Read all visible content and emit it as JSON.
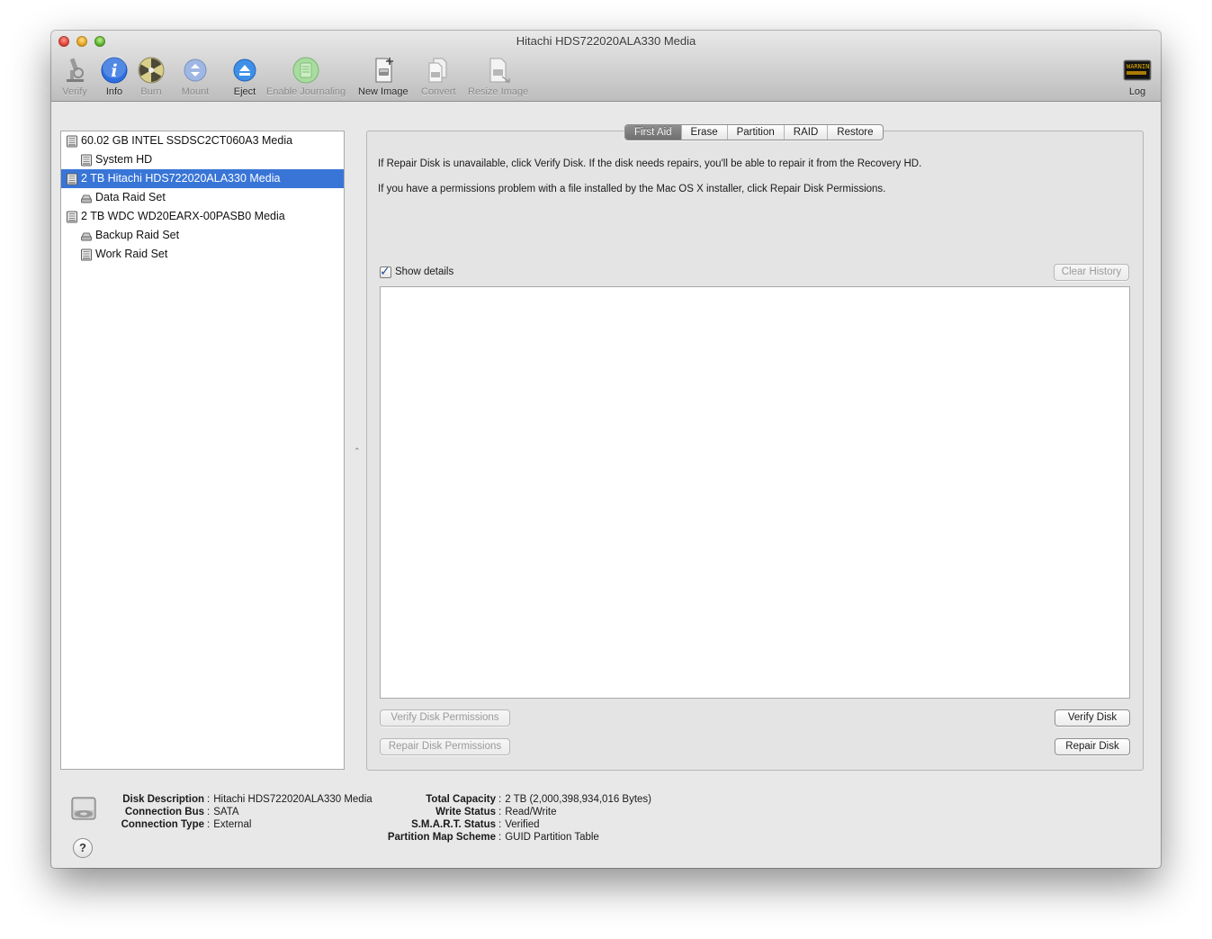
{
  "window": {
    "title": "Hitachi HDS722020ALA330 Media"
  },
  "toolbar": {
    "verify": "Verify",
    "info": "Info",
    "burn": "Burn",
    "mount": "Mount",
    "eject": "Eject",
    "enable_journaling": "Enable Journaling",
    "new_image": "New Image",
    "convert": "Convert",
    "resize_image": "Resize Image",
    "log": "Log",
    "log_icon_text": "WARNIN"
  },
  "sidebar": {
    "items": [
      {
        "label": "60.02 GB INTEL SSDSC2CT060A3 Media",
        "level": 0
      },
      {
        "label": "System HD",
        "level": 1
      },
      {
        "label": "2 TB Hitachi HDS722020ALA330 Media",
        "level": 0,
        "selected": true
      },
      {
        "label": "Data Raid Set",
        "level": 1
      },
      {
        "label": "2 TB WDC WD20EARX-00PASB0 Media",
        "level": 0
      },
      {
        "label": "Backup Raid Set",
        "level": 1
      },
      {
        "label": "Work Raid Set",
        "level": 1
      }
    ]
  },
  "tabs": [
    "First Aid",
    "Erase",
    "Partition",
    "RAID",
    "Restore"
  ],
  "first_aid": {
    "info1": "If Repair Disk is unavailable, click Verify Disk. If the disk needs repairs, you'll be able to repair it from the Recovery HD.",
    "info2": "If you have a permissions problem with a file installed by the Mac OS X installer, click Repair Disk Permissions.",
    "show_details": "Show details",
    "clear_history": "Clear History",
    "verify_permissions": "Verify Disk Permissions",
    "repair_permissions": "Repair Disk Permissions",
    "verify_disk": "Verify Disk",
    "repair_disk": "Repair Disk"
  },
  "disk_info": {
    "left": [
      {
        "key": "Disk Description",
        "value": "Hitachi HDS722020ALA330 Media"
      },
      {
        "key": "Connection Bus",
        "value": "SATA"
      },
      {
        "key": "Connection Type",
        "value": "External"
      }
    ],
    "right": [
      {
        "key": "Total Capacity",
        "value": "2 TB (2,000,398,934,016 Bytes)"
      },
      {
        "key": "Write Status",
        "value": "Read/Write"
      },
      {
        "key": "S.M.A.R.T. Status",
        "value": "Verified"
      },
      {
        "key": "Partition Map Scheme",
        "value": "GUID Partition Table"
      }
    ]
  },
  "help_label": "?",
  "colors": {
    "selection": "#3875d7",
    "info_blue": "#2d6fe0",
    "eject_blue": "#3d8fe8"
  }
}
